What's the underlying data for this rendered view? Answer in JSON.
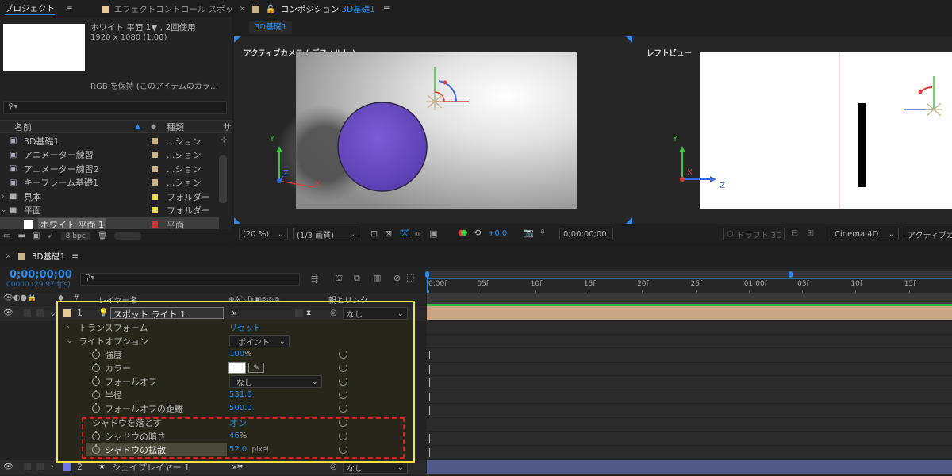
{
  "project_panel": {
    "tabs": [
      {
        "label": "プロジェクト",
        "active": true
      },
      {
        "label": "エフェクトコントロール スポット",
        "active": false
      }
    ],
    "menu_icon": "hamburger-icon",
    "expand_icon": "double-chevron-right-icon",
    "preview": {
      "name_line": "ホワイト 平面 1▼ , 2回使用",
      "dims_line": "1920 x 1080 (1.00)",
      "desc_line": "RGB を保持 (このアイテムのカラ…"
    },
    "search_placeholder": "",
    "columns": {
      "name": "名前",
      "type": "種類",
      "size_short": "サ"
    },
    "items": [
      {
        "name": "3D基礎1",
        "type": "...ション",
        "label_color": "#c9b389",
        "kind": "composition",
        "indent": 0,
        "selected": false
      },
      {
        "name": "アニメーター練習",
        "type": "...ション",
        "label_color": "#c9b389",
        "kind": "composition",
        "indent": 0,
        "selected": false
      },
      {
        "name": "アニメーター練習2",
        "type": "...ション",
        "label_color": "#c9b389",
        "kind": "composition",
        "indent": 0,
        "selected": false
      },
      {
        "name": "キーフレーム基礎1",
        "type": "...ション",
        "label_color": "#c9b389",
        "kind": "composition",
        "indent": 0,
        "selected": false
      },
      {
        "name": "見本",
        "type": "フォルダー",
        "label_color": "#e8d85c",
        "kind": "folder",
        "indent": 0,
        "selected": false
      },
      {
        "name": "平面",
        "type": "フォルダー",
        "label_color": "#e8d85c",
        "kind": "folder-open",
        "indent": 0,
        "selected": false
      },
      {
        "name": "ホワイト 平面 1",
        "type": "平面",
        "label_color": "#c23a3a",
        "kind": "solid",
        "indent": 1,
        "selected": true
      }
    ],
    "bpc": "8 bpc"
  },
  "composition_panel": {
    "tab_label": "コンポジション",
    "comp_name": "3D基礎1",
    "comp_tab": "3D基礎1",
    "left_view_label": "アクティブカメラ ( デフォルト )",
    "right_view_label": "レフトビュー",
    "zoom": "(20 %)",
    "resolution": "(1/3 画質)",
    "exposure": "+0.0",
    "timecode": "0;00;00;00",
    "draft3d": "ドラフト 3D",
    "renderer": "Cinema 4D",
    "camera": "アクティブカメラ",
    "colors": {
      "sphere": "#6c4fc2",
      "axis_x": "#e03a3a",
      "axis_y": "#3ec83e",
      "axis_z": "#3a6be0"
    },
    "axis_labels": {
      "x": "X",
      "y": "Y",
      "z": "Z"
    }
  },
  "timeline_panel": {
    "comp_name": "3D基礎1",
    "current_time": "0;00;00;00",
    "fps_line": "00000 (29.97 fps)",
    "search_placeholder": "",
    "column_layer_name": "レイヤー名",
    "column_parent": "親とリンク",
    "ruler": [
      {
        "label": "0:00f",
        "pos": 0
      },
      {
        "label": "05f",
        "pos": 1
      },
      {
        "label": "10f",
        "pos": 2
      },
      {
        "label": "15f",
        "pos": 3
      },
      {
        "label": "20f",
        "pos": 4
      },
      {
        "label": "25f",
        "pos": 5
      },
      {
        "label": "01:00f",
        "pos": 6
      },
      {
        "label": "05f",
        "pos": 7
      },
      {
        "label": "10f",
        "pos": 8
      },
      {
        "label": "15f",
        "pos": 9
      }
    ],
    "layers": [
      {
        "num": "1",
        "name": "スポット ライト 1",
        "parent": "なし",
        "switch_char": "#",
        "label_color": "#e6c99a",
        "icon": "lightbulb-icon",
        "bar_color": "#c9a684"
      },
      {
        "num": "2",
        "name": "シェイプレイヤー 1",
        "parent": "なし",
        "switch_char": "#",
        "label_color": "#6f76e0",
        "icon": "star-icon",
        "bar_color": "#525a86"
      }
    ],
    "properties": {
      "transform": "トランスフォーム",
      "reset": "リセット",
      "light_options": "ライトオプション",
      "light_type": "ポイント",
      "intensity_label": "強度",
      "intensity_value": "100",
      "intensity_unit": "%",
      "color_label": "カラー",
      "color_value": "#ffffff",
      "falloff_label": "フォールオフ",
      "falloff_value": "なし",
      "radius_label": "半径",
      "radius_value": "531.0",
      "falloff_distance_label": "フォールオフの距離",
      "falloff_distance_value": "500.0",
      "casts_shadows_label": "シャドウを落とす",
      "casts_shadows_value": "オン",
      "shadow_darkness_label": "シャドウの暗さ",
      "shadow_darkness_value": "46",
      "shadow_darkness_unit": "%",
      "shadow_diffusion_label": "シャドウの拡散",
      "shadow_diffusion_value": "52.0",
      "shadow_diffusion_unit": "pixel"
    }
  }
}
